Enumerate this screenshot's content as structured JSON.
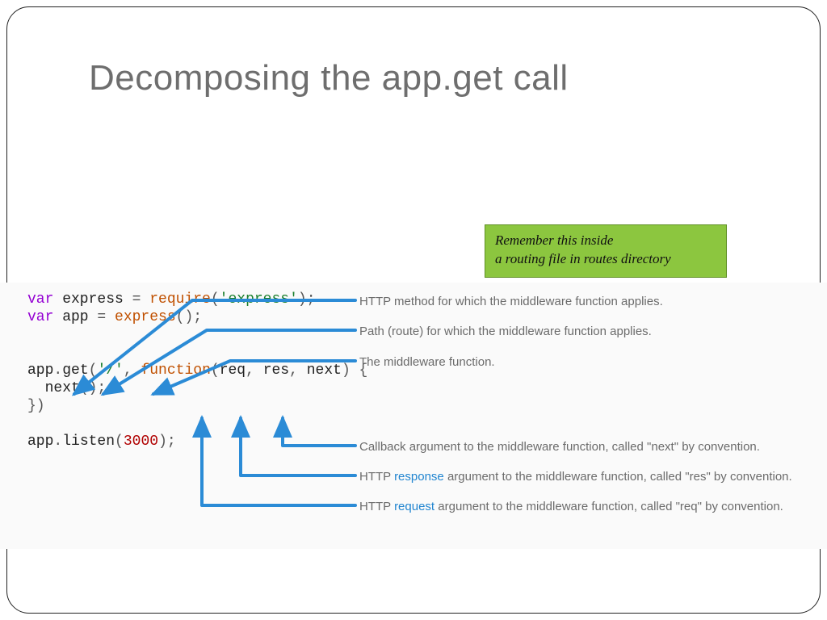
{
  "title": "Decomposing the app.get call",
  "greenbox": {
    "line1": "Remember this inside",
    "line2": "a routing file in routes directory"
  },
  "code": {
    "l1_var": "var",
    "l1_express": " express ",
    "l1_require": "require",
    "l1_str": "'express'",
    "l2_var": "var",
    "l2_app": " app ",
    "l2_express": "express",
    "l3_app": "app",
    "l3_get": "get",
    "l3_path": "'/'",
    "l3_function": "function",
    "l3_req": "req",
    "l3_res": "res",
    "l3_next": "next",
    "l4_next": "next",
    "l6_app": "app",
    "l6_listen": "listen",
    "l6_port": "3000"
  },
  "labels": {
    "method": "HTTP method for which the middleware function applies.",
    "path": "Path (route) for which the middleware function applies.",
    "middleware": "The middleware function.",
    "next": "Callback argument to the middleware function, called \"next\" by convention.",
    "res_pre": "HTTP ",
    "res_link": "response",
    "res_post": " argument to the middleware function, called \"res\" by convention.",
    "req_pre": "HTTP ",
    "req_link": "request",
    "req_post": " argument to the middleware function, called \"req\" by convention."
  },
  "colors": {
    "arrow": "#2b8bd6",
    "green": "#8cc63f"
  }
}
